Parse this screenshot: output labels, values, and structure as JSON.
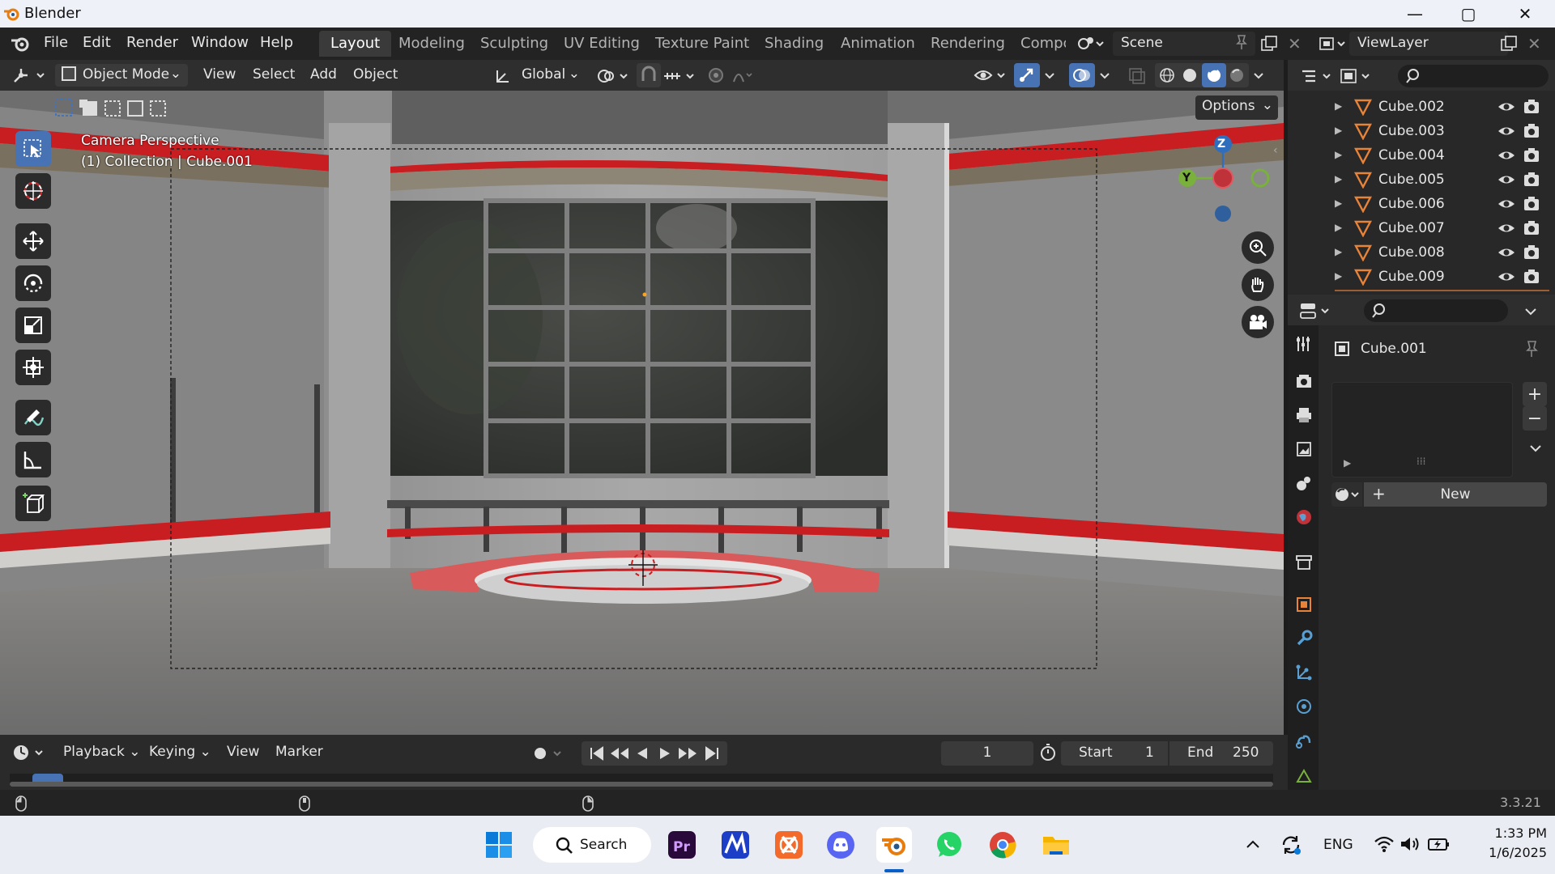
{
  "window": {
    "title": "Blender",
    "minimize": "—",
    "maximize": "▢",
    "close": "✕"
  },
  "menu": [
    "File",
    "Edit",
    "Render",
    "Window",
    "Help"
  ],
  "workspaces": [
    "Layout",
    "Modeling",
    "Sculpting",
    "UV Editing",
    "Texture Paint",
    "Shading",
    "Animation",
    "Rendering",
    "Compc"
  ],
  "scene": {
    "name": "Scene"
  },
  "viewlayer": {
    "name": "ViewLayer"
  },
  "header": {
    "mode": "Object Mode",
    "view": "View",
    "select": "Select",
    "add": "Add",
    "object": "Object",
    "transform": "Global",
    "options": "Options"
  },
  "viewport": {
    "perspective": "Camera Perspective",
    "collection": "(1) Collection | Cube.001",
    "gizmo": {
      "z": "Z",
      "y": "Y"
    }
  },
  "outliner": {
    "items": [
      "Cube.002",
      "Cube.003",
      "Cube.004",
      "Cube.005",
      "Cube.006",
      "Cube.007",
      "Cube.008",
      "Cube.009"
    ]
  },
  "properties": {
    "object": "Cube.001",
    "new_label": "New"
  },
  "timeline": {
    "playback": "Playback",
    "keying": "Keying",
    "view": "View",
    "marker": "Marker",
    "frame": "1",
    "start_label": "Start",
    "start": "1",
    "end_label": "End",
    "end": "250"
  },
  "status": {
    "version": "3.3.21"
  },
  "taskbar": {
    "search": "Search",
    "lang": "ENG",
    "time": "1:33 PM",
    "date": "1/6/2025"
  },
  "colors": {
    "accent": "#4772b3",
    "red_trim": "#c81e22",
    "object_orange": "#e8833a"
  }
}
